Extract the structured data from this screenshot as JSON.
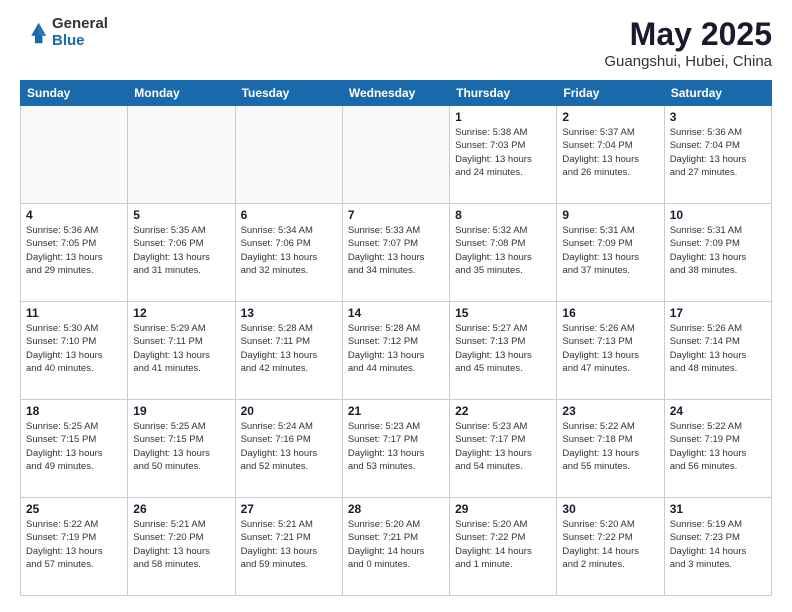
{
  "logo": {
    "general": "General",
    "blue": "Blue"
  },
  "header": {
    "month": "May 2025",
    "location": "Guangshui, Hubei, China"
  },
  "weekdays": [
    "Sunday",
    "Monday",
    "Tuesday",
    "Wednesday",
    "Thursday",
    "Friday",
    "Saturday"
  ],
  "weeks": [
    [
      {
        "day": "",
        "info": ""
      },
      {
        "day": "",
        "info": ""
      },
      {
        "day": "",
        "info": ""
      },
      {
        "day": "",
        "info": ""
      },
      {
        "day": "1",
        "info": "Sunrise: 5:38 AM\nSunset: 7:03 PM\nDaylight: 13 hours\nand 24 minutes."
      },
      {
        "day": "2",
        "info": "Sunrise: 5:37 AM\nSunset: 7:04 PM\nDaylight: 13 hours\nand 26 minutes."
      },
      {
        "day": "3",
        "info": "Sunrise: 5:36 AM\nSunset: 7:04 PM\nDaylight: 13 hours\nand 27 minutes."
      }
    ],
    [
      {
        "day": "4",
        "info": "Sunrise: 5:36 AM\nSunset: 7:05 PM\nDaylight: 13 hours\nand 29 minutes."
      },
      {
        "day": "5",
        "info": "Sunrise: 5:35 AM\nSunset: 7:06 PM\nDaylight: 13 hours\nand 31 minutes."
      },
      {
        "day": "6",
        "info": "Sunrise: 5:34 AM\nSunset: 7:06 PM\nDaylight: 13 hours\nand 32 minutes."
      },
      {
        "day": "7",
        "info": "Sunrise: 5:33 AM\nSunset: 7:07 PM\nDaylight: 13 hours\nand 34 minutes."
      },
      {
        "day": "8",
        "info": "Sunrise: 5:32 AM\nSunset: 7:08 PM\nDaylight: 13 hours\nand 35 minutes."
      },
      {
        "day": "9",
        "info": "Sunrise: 5:31 AM\nSunset: 7:09 PM\nDaylight: 13 hours\nand 37 minutes."
      },
      {
        "day": "10",
        "info": "Sunrise: 5:31 AM\nSunset: 7:09 PM\nDaylight: 13 hours\nand 38 minutes."
      }
    ],
    [
      {
        "day": "11",
        "info": "Sunrise: 5:30 AM\nSunset: 7:10 PM\nDaylight: 13 hours\nand 40 minutes."
      },
      {
        "day": "12",
        "info": "Sunrise: 5:29 AM\nSunset: 7:11 PM\nDaylight: 13 hours\nand 41 minutes."
      },
      {
        "day": "13",
        "info": "Sunrise: 5:28 AM\nSunset: 7:11 PM\nDaylight: 13 hours\nand 42 minutes."
      },
      {
        "day": "14",
        "info": "Sunrise: 5:28 AM\nSunset: 7:12 PM\nDaylight: 13 hours\nand 44 minutes."
      },
      {
        "day": "15",
        "info": "Sunrise: 5:27 AM\nSunset: 7:13 PM\nDaylight: 13 hours\nand 45 minutes."
      },
      {
        "day": "16",
        "info": "Sunrise: 5:26 AM\nSunset: 7:13 PM\nDaylight: 13 hours\nand 47 minutes."
      },
      {
        "day": "17",
        "info": "Sunrise: 5:26 AM\nSunset: 7:14 PM\nDaylight: 13 hours\nand 48 minutes."
      }
    ],
    [
      {
        "day": "18",
        "info": "Sunrise: 5:25 AM\nSunset: 7:15 PM\nDaylight: 13 hours\nand 49 minutes."
      },
      {
        "day": "19",
        "info": "Sunrise: 5:25 AM\nSunset: 7:15 PM\nDaylight: 13 hours\nand 50 minutes."
      },
      {
        "day": "20",
        "info": "Sunrise: 5:24 AM\nSunset: 7:16 PM\nDaylight: 13 hours\nand 52 minutes."
      },
      {
        "day": "21",
        "info": "Sunrise: 5:23 AM\nSunset: 7:17 PM\nDaylight: 13 hours\nand 53 minutes."
      },
      {
        "day": "22",
        "info": "Sunrise: 5:23 AM\nSunset: 7:17 PM\nDaylight: 13 hours\nand 54 minutes."
      },
      {
        "day": "23",
        "info": "Sunrise: 5:22 AM\nSunset: 7:18 PM\nDaylight: 13 hours\nand 55 minutes."
      },
      {
        "day": "24",
        "info": "Sunrise: 5:22 AM\nSunset: 7:19 PM\nDaylight: 13 hours\nand 56 minutes."
      }
    ],
    [
      {
        "day": "25",
        "info": "Sunrise: 5:22 AM\nSunset: 7:19 PM\nDaylight: 13 hours\nand 57 minutes."
      },
      {
        "day": "26",
        "info": "Sunrise: 5:21 AM\nSunset: 7:20 PM\nDaylight: 13 hours\nand 58 minutes."
      },
      {
        "day": "27",
        "info": "Sunrise: 5:21 AM\nSunset: 7:21 PM\nDaylight: 13 hours\nand 59 minutes."
      },
      {
        "day": "28",
        "info": "Sunrise: 5:20 AM\nSunset: 7:21 PM\nDaylight: 14 hours\nand 0 minutes."
      },
      {
        "day": "29",
        "info": "Sunrise: 5:20 AM\nSunset: 7:22 PM\nDaylight: 14 hours\nand 1 minute."
      },
      {
        "day": "30",
        "info": "Sunrise: 5:20 AM\nSunset: 7:22 PM\nDaylight: 14 hours\nand 2 minutes."
      },
      {
        "day": "31",
        "info": "Sunrise: 5:19 AM\nSunset: 7:23 PM\nDaylight: 14 hours\nand 3 minutes."
      }
    ]
  ]
}
